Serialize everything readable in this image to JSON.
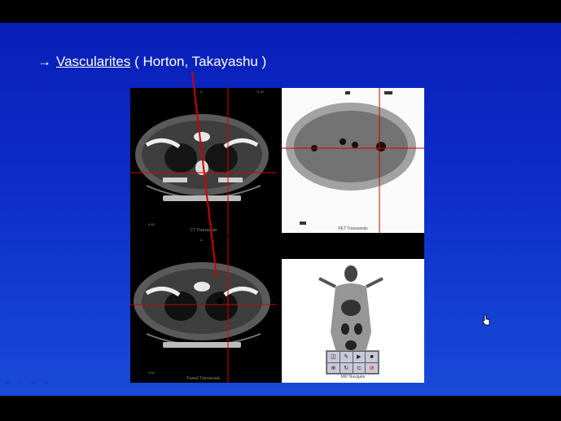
{
  "slide": {
    "bullet": {
      "arrow": "→",
      "link_text": "Vascularites",
      "rest_text": " ( Horton, Takayashu )"
    },
    "panel_captions": {
      "ct": "CT Transaxials",
      "pet": "PET Transaxials",
      "fused": "Fused Transaxials",
      "mip": "MIP Navigate"
    },
    "small_labels": {
      "ct_top": "A",
      "ct_top_right": "+1.30",
      "ct_bottom_left": "4.83",
      "fused_top": "A",
      "fused_bottom_left": "4.83",
      "pet_bottom_left": "",
      "mip_bottom_right": ""
    }
  },
  "icons": {
    "pointer": "hand-pointer-icon",
    "tools": [
      "measure-icon",
      "draw-icon",
      "play-icon",
      "stop-icon",
      "zoom-icon",
      "rotate-icon",
      "link-icon",
      "cancel-icon"
    ]
  },
  "colors": {
    "slide_top": "#0a1eb8",
    "slide_bottom": "#1a4ad8",
    "crosshair": "#d40000",
    "text": "#ffffff"
  }
}
